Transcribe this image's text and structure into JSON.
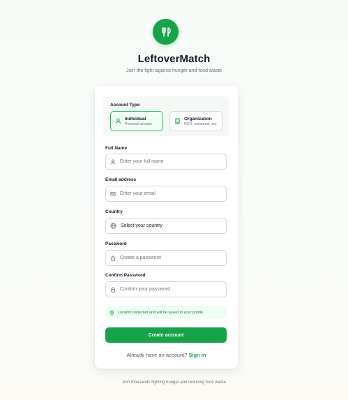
{
  "app": {
    "title": "LeftoverMatch",
    "subtitle": "Join the fight against hunger and food waste",
    "logo_icon": "fork-knife-icon",
    "accent": "#16a34a"
  },
  "account_type": {
    "label": "Account Type",
    "options": [
      {
        "label": "Individual",
        "sub": "Personal account",
        "icon": "user-icon",
        "selected": true
      },
      {
        "label": "Organization",
        "sub": "NGO, restaurant, etc.",
        "icon": "building-icon",
        "selected": false
      }
    ]
  },
  "fields": {
    "full_name": {
      "label": "Full Name",
      "placeholder": "Enter your full name"
    },
    "email": {
      "label": "Email address",
      "placeholder": "Enter your email"
    },
    "country": {
      "label": "Country",
      "value": "Select your country"
    },
    "password": {
      "label": "Password",
      "placeholder": "Create a password"
    },
    "confirm_password": {
      "label": "Confirm Password",
      "placeholder": "Confirm your password"
    }
  },
  "location_notice": "Location detected and will be saved to your profile",
  "submit_label": "Create account",
  "signin": {
    "prompt": "Already have an account?",
    "link": "Sign in"
  },
  "footer": "Join thousands fighting hunger and reducing food waste"
}
